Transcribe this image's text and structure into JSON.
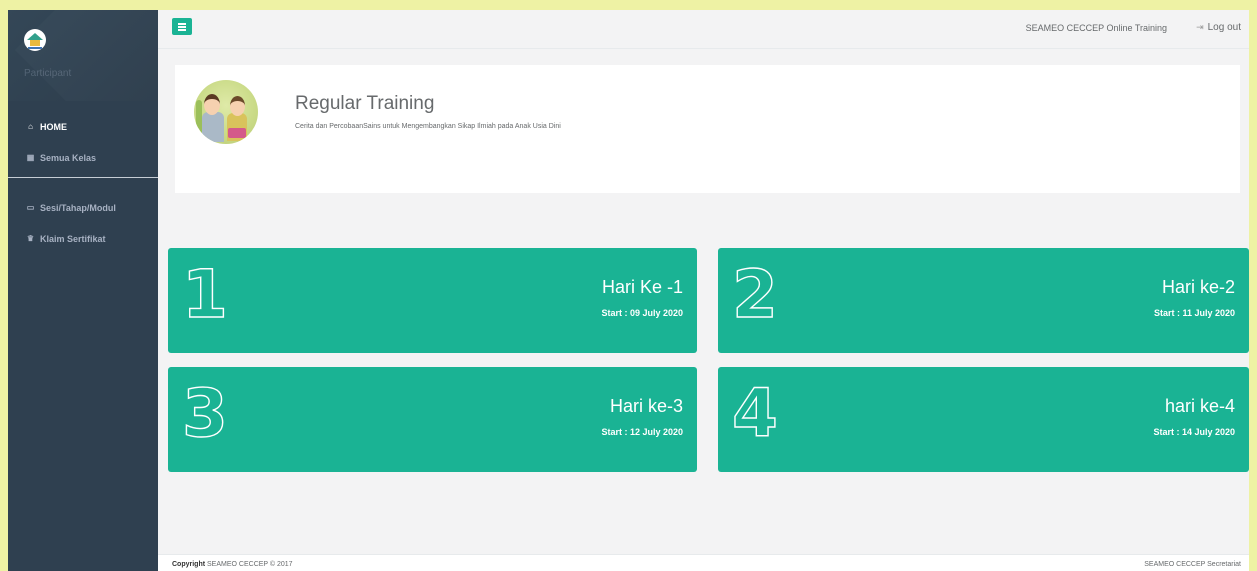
{
  "sidebar": {
    "role": "Participant",
    "items": [
      {
        "icon": "home-icon",
        "label": "HOME"
      },
      {
        "icon": "calendar-icon",
        "label": "Semua Kelas"
      },
      {
        "icon": "folder-icon",
        "label": "Sesi/Tahap/Modul"
      },
      {
        "icon": "trophy-icon",
        "label": "Klaim Sertifikat"
      }
    ]
  },
  "topbar": {
    "site_name": "SEAMEO CECCEP Online Training",
    "logout_label": "Log out"
  },
  "header": {
    "title": "Regular Training",
    "subtitle": "Cerita dan PercobaanSains untuk Mengembangkan Sikap Ilmiah pada Anak Usia Dini"
  },
  "days": [
    {
      "number": "1",
      "title": "Hari Ke -1",
      "start": "Start : 09 July 2020"
    },
    {
      "number": "2",
      "title": "Hari ke-2",
      "start": "Start : 11 July 2020"
    },
    {
      "number": "3",
      "title": "Hari ke-3",
      "start": "Start : 12 July 2020"
    },
    {
      "number": "4",
      "title": "hari ke-4",
      "start": "Start : 14 July 2020"
    }
  ],
  "footer": {
    "copyright_bold": "Copyright",
    "copyright_text": "SEAMEO CECCEP © 2017",
    "right": "SEAMEO CECCEP Secretariat"
  },
  "colors": {
    "accent": "#1ab394",
    "sidebar_bg": "#2f4050",
    "page_bg": "#f3f3f4"
  }
}
